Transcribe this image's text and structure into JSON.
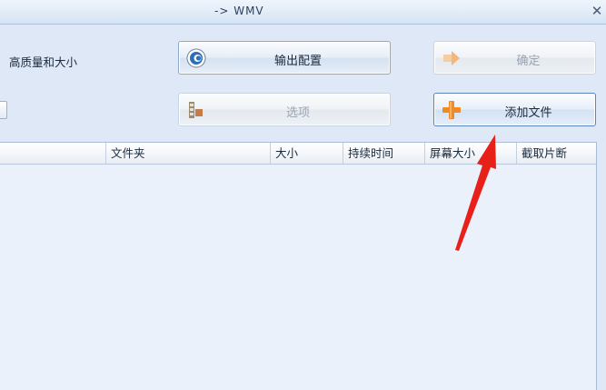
{
  "window": {
    "title": "-> WMV",
    "close_icon": "close-icon"
  },
  "left_label": "高质量和大小",
  "buttons": {
    "output_config": {
      "label": "输出配置",
      "icon": "config-disc-icon"
    },
    "confirm": {
      "label": "确定",
      "icon": "arrow-right-icon"
    },
    "options": {
      "label": "选项",
      "icon": "film-options-icon"
    },
    "add_file": {
      "label": "添加文件",
      "icon": "plus-icon"
    }
  },
  "table": {
    "columns": [
      "文件夹",
      "大小",
      "持续时间",
      "屏幕大小",
      "截取片断"
    ],
    "rows": []
  },
  "colors": {
    "accent_orange": "#f08a24",
    "annotation_red": "#e8201a",
    "window_bg": "#dfe8f6"
  }
}
